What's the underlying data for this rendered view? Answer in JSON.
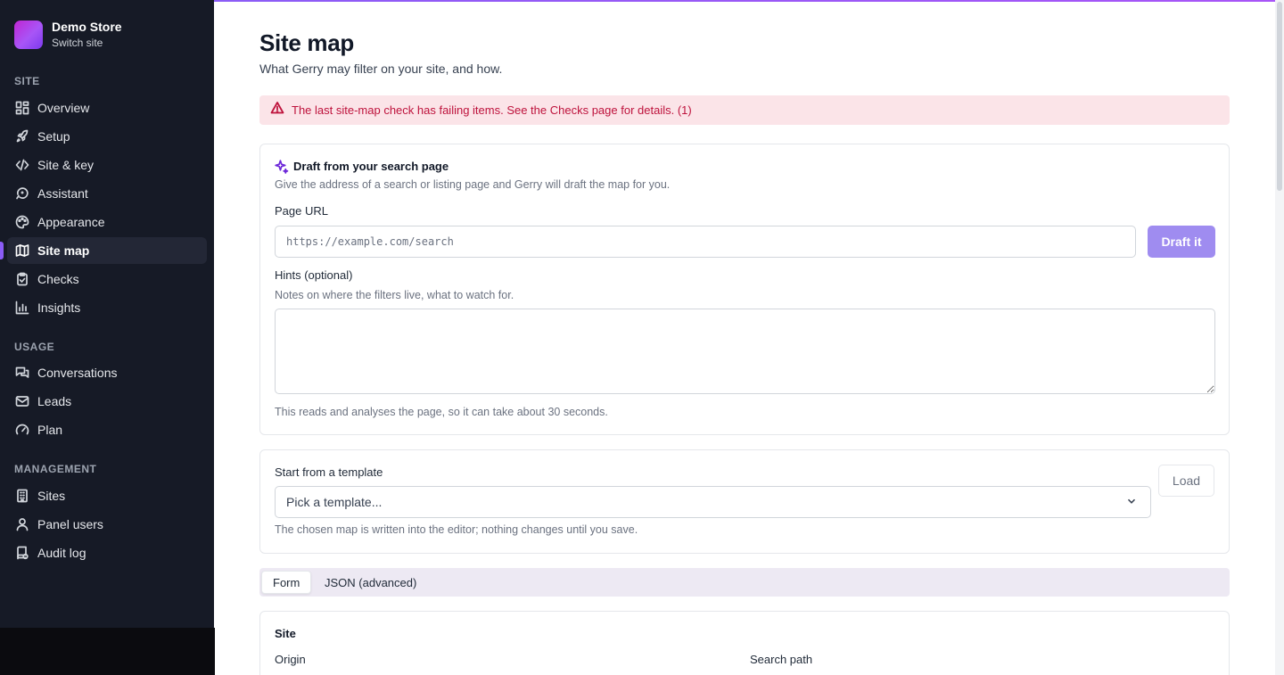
{
  "store": {
    "name": "Demo Store",
    "switch_label": "Switch site"
  },
  "sidebar": {
    "sections": [
      {
        "label": "SITE",
        "items": [
          {
            "label": "Overview",
            "icon": "dashboard-icon"
          },
          {
            "label": "Setup",
            "icon": "rocket-icon"
          },
          {
            "label": "Site & key",
            "icon": "code-icon"
          },
          {
            "label": "Assistant",
            "icon": "bot-icon"
          },
          {
            "label": "Appearance",
            "icon": "palette-icon"
          },
          {
            "label": "Site map",
            "icon": "map-icon",
            "active": true
          },
          {
            "label": "Checks",
            "icon": "clipboard-check-icon"
          },
          {
            "label": "Insights",
            "icon": "bar-chart-icon"
          }
        ]
      },
      {
        "label": "USAGE",
        "items": [
          {
            "label": "Conversations",
            "icon": "chat-icon"
          },
          {
            "label": "Leads",
            "icon": "inbox-icon"
          },
          {
            "label": "Plan",
            "icon": "gauge-icon"
          }
        ]
      },
      {
        "label": "MANAGEMENT",
        "items": [
          {
            "label": "Sites",
            "icon": "building-icon"
          },
          {
            "label": "Panel users",
            "icon": "user-icon"
          },
          {
            "label": "Audit log",
            "icon": "audit-icon"
          }
        ]
      }
    ]
  },
  "page": {
    "title": "Site map",
    "subtitle": "What Gerry may filter on your site, and how."
  },
  "alert": {
    "text": "The last site-map check has failing items. See the Checks page for details. (1)"
  },
  "draft": {
    "title": "Draft from your search page",
    "description": "Give the address of a search or listing page and Gerry will draft the map for you.",
    "url_label": "Page URL",
    "url_placeholder": "https://example.com/search",
    "button": "Draft it",
    "hints_label": "Hints (optional)",
    "hints_help": "Notes on where the filters live, what to watch for.",
    "hints_value": "",
    "note": "This reads and analyses the page, so it can take about 30 seconds."
  },
  "template": {
    "title": "Start from a template",
    "placeholder": "Pick a template...",
    "load_button": "Load",
    "note": "The chosen map is written into the editor; nothing changes until you save."
  },
  "tabs": [
    {
      "label": "Form",
      "active": true
    },
    {
      "label": "JSON (advanced)",
      "active": false
    }
  ],
  "site_section": {
    "title": "Site",
    "origin_label": "Origin",
    "search_path_label": "Search path"
  },
  "colors": {
    "accent": "#8b5cf6",
    "sidebar_bg": "#161a26",
    "alert_bg": "#fbe4e8",
    "alert_text": "#be123c",
    "primary_button": "#9f8cf0"
  }
}
